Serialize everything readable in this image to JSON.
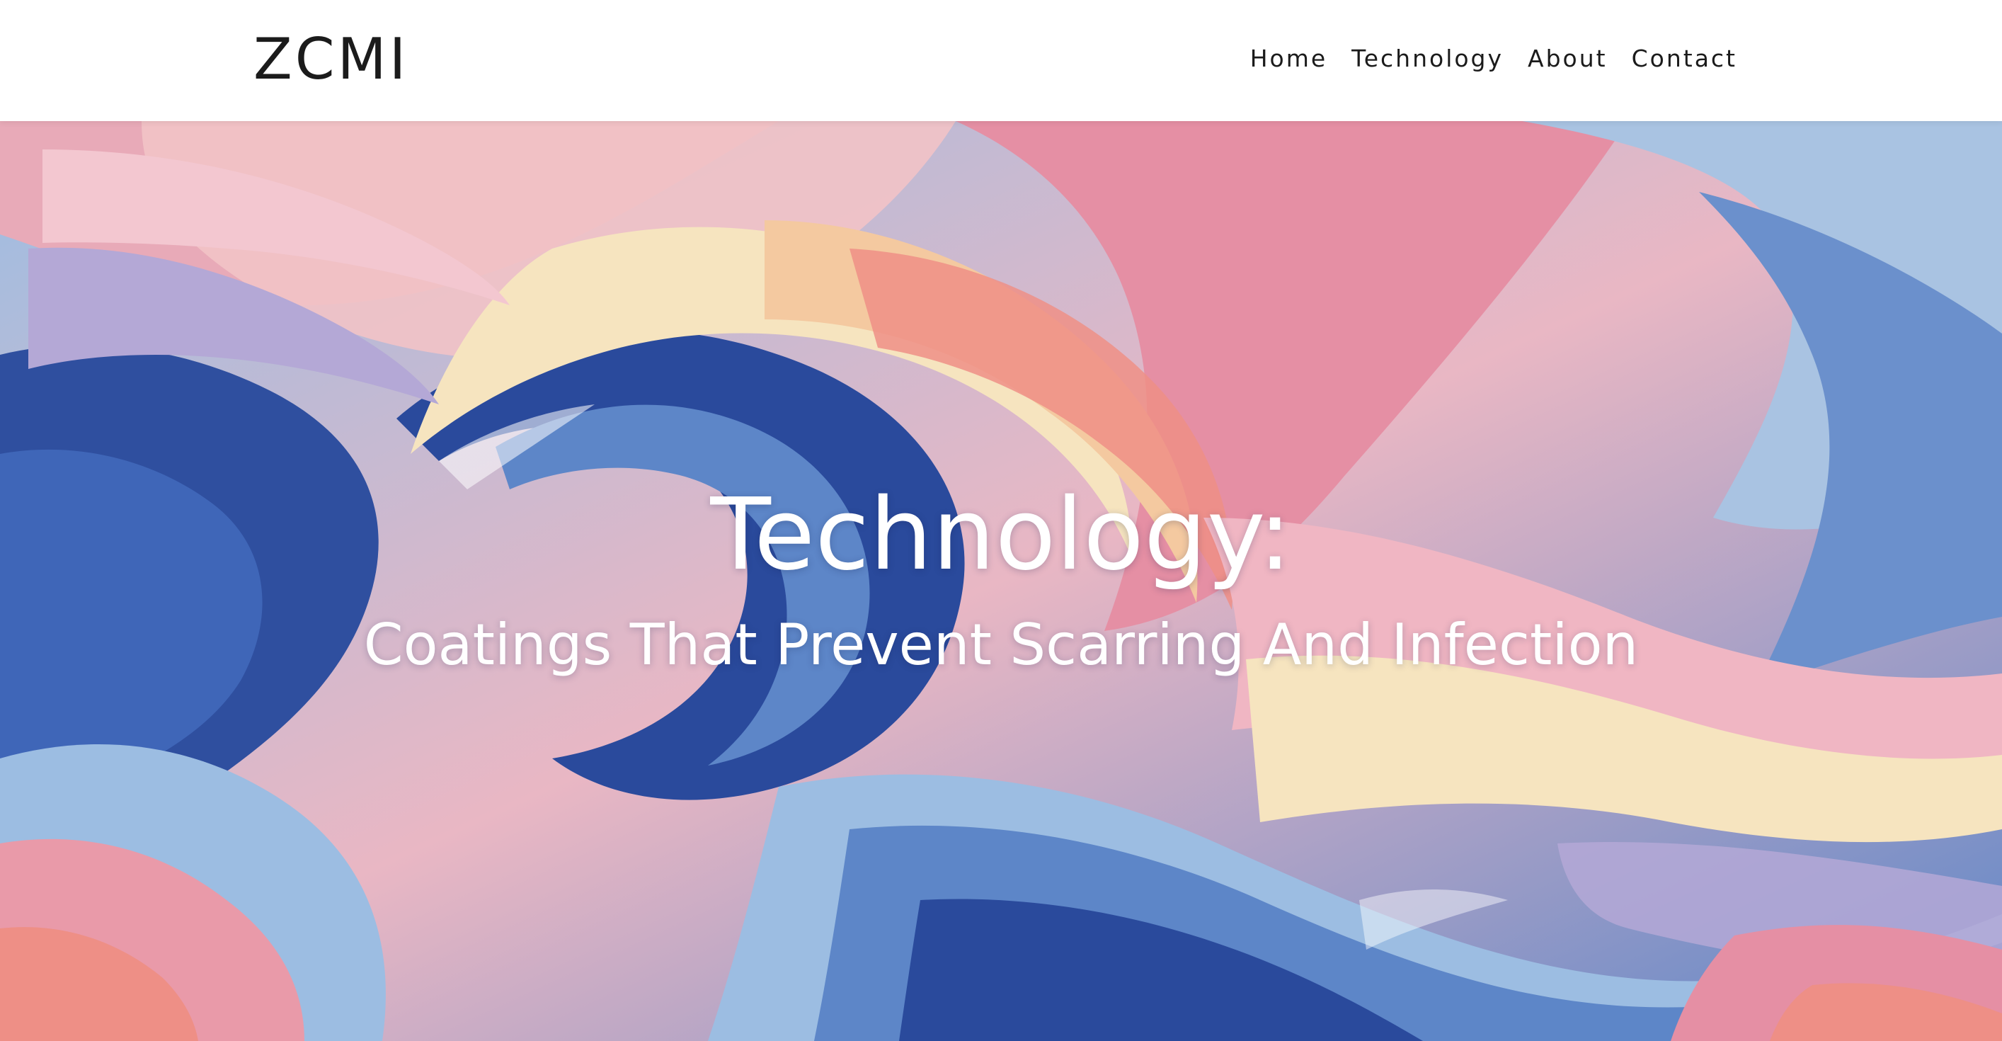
{
  "header": {
    "logo": "ZCMI",
    "nav": [
      "Home",
      "Technology",
      "About",
      "Contact"
    ]
  },
  "hero": {
    "title": "Technology:",
    "subtitle": "Coatings That Prevent Scarring And Infection",
    "background": "abstract-swirling-paint-artwork",
    "palette": {
      "navy": "#2a4a9c",
      "blue": "#5d86c8",
      "light_blue": "#9cbde2",
      "pink": "#e79bb0",
      "coral": "#ee8f86",
      "peach": "#f4c9a0",
      "cream": "#f6e4bf",
      "lavender": "#b4a8d6"
    }
  }
}
